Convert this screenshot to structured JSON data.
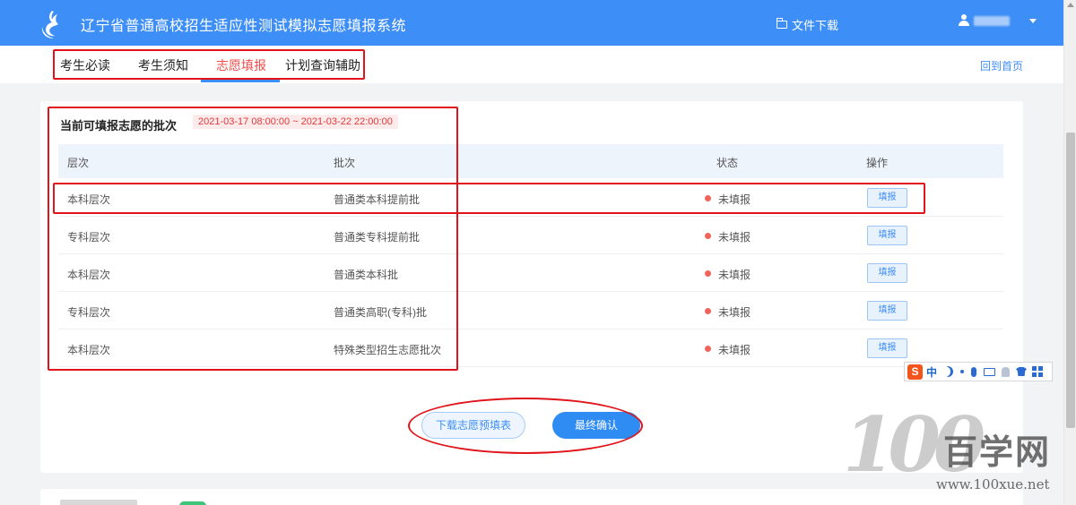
{
  "header": {
    "logo": "pigeon-logo-icon",
    "title": "辽宁省普通高校招生适应性测试模拟志愿填报系统",
    "file_download": "文件下载",
    "user_name": ""
  },
  "nav": {
    "tabs": [
      {
        "label": "考生必读"
      },
      {
        "label": "考生须知"
      },
      {
        "label": "志愿填报",
        "active": true
      },
      {
        "label": "计划查询辅助"
      }
    ],
    "home": "回到首页"
  },
  "batch": {
    "title": "当前可填报志愿的批次",
    "date_range": "2021-03-17 08:00:00 ~ 2021-03-22 22:00:00",
    "columns": {
      "level": "层次",
      "batch": "批次",
      "status": "状态",
      "action": "操作"
    },
    "rows": [
      {
        "level": "本科层次",
        "batch": "普通类本科提前批",
        "status": "未填报",
        "action": "填报"
      },
      {
        "level": "专科层次",
        "batch": "普通类专科提前批",
        "status": "未填报",
        "action": "填报"
      },
      {
        "level": "本科层次",
        "batch": "普通类本科批",
        "status": "未填报",
        "action": "填报"
      },
      {
        "level": "专科层次",
        "batch": "普通类高职(专科)批",
        "status": "未填报",
        "action": "填报"
      },
      {
        "level": "本科层次",
        "batch": "特殊类型招生志愿批次",
        "status": "未填报",
        "action": "填报"
      }
    ],
    "download_btn": "下载志愿预填表",
    "confirm_btn": "最终确认"
  },
  "ime": {
    "logo": "S",
    "mode": "中"
  },
  "watermark": {
    "digits": "100",
    "cn": "百学网",
    "url": "www.100xue.net"
  },
  "colors": {
    "primary": "#3e8ef7",
    "active_tab": "#f04b4b",
    "annotation": "#e0141a",
    "status_dot": "#f0645a"
  }
}
